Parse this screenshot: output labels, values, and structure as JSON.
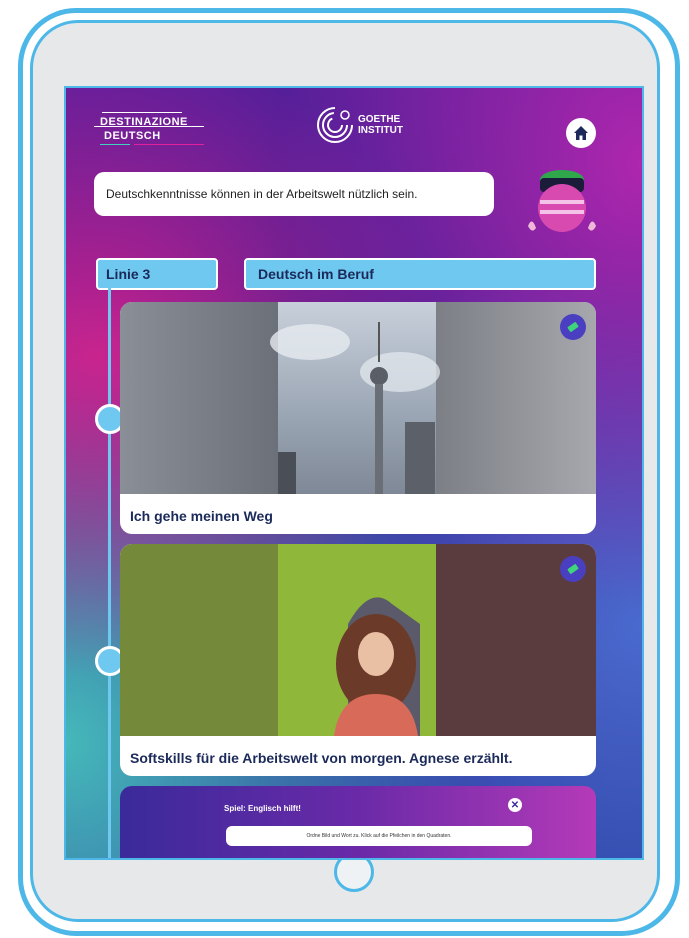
{
  "header": {
    "logo_line1": "DESTINAZIONE",
    "logo_line2": "DEUTSCH",
    "goethe_line1": "GOETHE",
    "goethe_line2": "INSTITUT"
  },
  "info_text": "Deutschkenntnisse können in der Arbeitswelt nützlich sein.",
  "line_label": "Linie 3",
  "section_title": "Deutsch im Beruf",
  "cards": [
    {
      "title": "Ich gehe meinen Weg",
      "badge_icon": "ticket-icon"
    },
    {
      "title": "Softskills für die Arbeitswelt von morgen. Agnese erzählt.",
      "badge_icon": "ticket-icon"
    }
  ],
  "game_card": {
    "title": "Spiel: Englisch hilft!",
    "instruction": "Ordne Bild und Wort zu. Klick auf die Pfeilchen in den Quadraten."
  },
  "colors": {
    "accent": "#6fc8f0",
    "frame": "#4db8e8",
    "text_dark": "#1b2a5a",
    "badge": "#4a3fc0",
    "badge_icon": "#3ed47a"
  }
}
